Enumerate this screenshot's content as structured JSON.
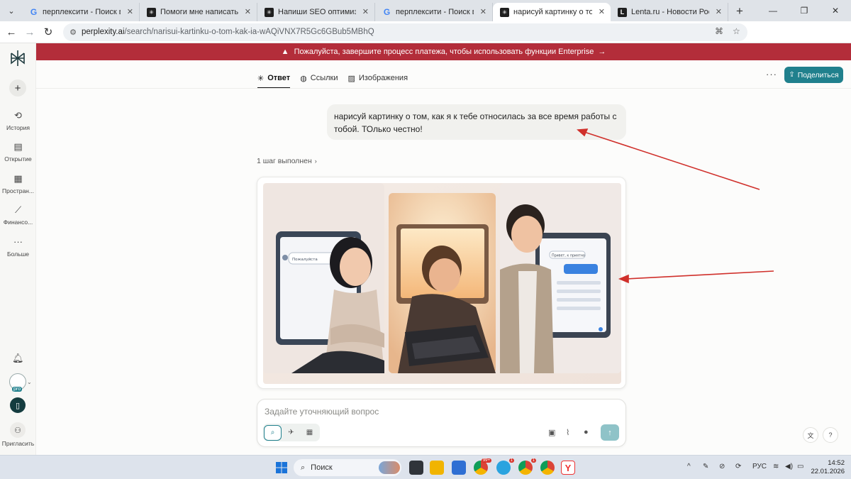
{
  "browser": {
    "tabs": [
      {
        "title": "перплексити - Поиск в Google",
        "favicon": "google-icon",
        "active": false
      },
      {
        "title": "Помоги мне написать самый",
        "favicon": "perplexity-icon",
        "active": false
      },
      {
        "title": "Напиши SEO оптимизирован",
        "favicon": "perplexity-icon",
        "active": false
      },
      {
        "title": "перплексити - Поиск в Google",
        "favicon": "google-icon",
        "active": false
      },
      {
        "title": "нарисуй картинку о том, как я",
        "favicon": "perplexity-icon",
        "active": true
      },
      {
        "title": "Lenta.ru - Новости России и м",
        "favicon": "lenta-icon",
        "active": false
      }
    ],
    "address": {
      "host": "perplexity.ai",
      "path": "/search/narisui-kartinku-o-tom-kak-ia-wAQiVNX7R5Gc6GBub5MBhQ"
    }
  },
  "sidebar": {
    "items": [
      {
        "label": "История",
        "icon": "history-icon"
      },
      {
        "label": "Открытие",
        "icon": "discover-icon"
      },
      {
        "label": "Простран...",
        "icon": "spaces-icon"
      },
      {
        "label": "Финансо...",
        "icon": "finance-icon"
      },
      {
        "label": "Больше",
        "icon": "more-icon"
      }
    ],
    "avatar_badge": "pro",
    "invite_label": "Пригласить"
  },
  "banner": {
    "text": "Пожалуйста, завершите процесс платежа, чтобы использовать функции Enterprise",
    "color": "#b32d3a"
  },
  "header": {
    "tabs": [
      {
        "label": "Ответ",
        "icon": "perplexity-answer-icon",
        "active": true
      },
      {
        "label": "Ссылки",
        "icon": "globe-icon",
        "active": false
      },
      {
        "label": "Изображения",
        "icon": "image-icon",
        "active": false
      }
    ],
    "share_label": "Поделиться",
    "accent": "#20808d"
  },
  "conversation": {
    "user_message": "нарисуй картинку о том, как я к тебе относилась за все время работы с тобой. ТОлько честно!",
    "steps_label": "1 шаг выполнен",
    "image_panels": {
      "left_chat_bubble": "Пожалуйста",
      "right_chat_bubble": "Привет, к приятно"
    }
  },
  "composer": {
    "placeholder": "Задайте уточняющий вопрос"
  },
  "taskbar": {
    "search_label": "Поиск",
    "language": "РУС",
    "time": "14:52",
    "date": "22.01.2026",
    "badges": [
      "99+",
      "1",
      "1"
    ]
  }
}
